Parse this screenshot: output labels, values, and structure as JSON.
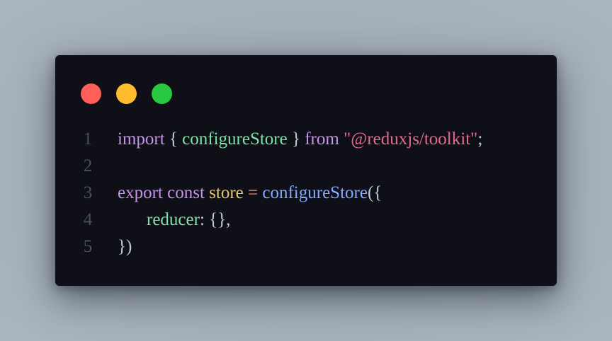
{
  "window": {
    "dots": [
      {
        "name": "close",
        "color": "#ff5f57"
      },
      {
        "name": "minimize",
        "color": "#febc2e"
      },
      {
        "name": "maximize",
        "color": "#28c840"
      }
    ]
  },
  "colors": {
    "background": "#0e0f17",
    "line_number": "#4b4f60",
    "keyword": "#c792ea",
    "identifier": "#7ee3a8",
    "punctuation": "#c3c9d9",
    "string": "#e56a8f",
    "variable": "#e6c66b",
    "operator": "#f78c6c",
    "function": "#82aaff"
  },
  "code": {
    "lines": [
      {
        "number": "1",
        "tokens": [
          {
            "text": "import",
            "color": "#c792ea"
          },
          {
            "text": " { ",
            "color": "#c3c9d9"
          },
          {
            "text": "configureStore",
            "color": "#7ee3a8"
          },
          {
            "text": " } ",
            "color": "#c3c9d9"
          },
          {
            "text": "from",
            "color": "#c792ea"
          },
          {
            "text": " ",
            "color": "#c3c9d9"
          },
          {
            "text": "\"@reduxjs/toolkit\"",
            "color": "#e56a8f"
          },
          {
            "text": ";",
            "color": "#c3c9d9"
          }
        ]
      },
      {
        "number": "2",
        "tokens": []
      },
      {
        "number": "3",
        "tokens": [
          {
            "text": "export",
            "color": "#c792ea"
          },
          {
            "text": " ",
            "color": "#c3c9d9"
          },
          {
            "text": "const",
            "color": "#c792ea"
          },
          {
            "text": " ",
            "color": "#c3c9d9"
          },
          {
            "text": "store",
            "color": "#e6c66b"
          },
          {
            "text": " ",
            "color": "#c3c9d9"
          },
          {
            "text": "=",
            "color": "#f78c6c"
          },
          {
            "text": " ",
            "color": "#c3c9d9"
          },
          {
            "text": "configureStore",
            "color": "#82aaff"
          },
          {
            "text": "({",
            "color": "#c3c9d9"
          }
        ]
      },
      {
        "number": "4",
        "indent": true,
        "tokens": [
          {
            "text": "reducer",
            "color": "#7ee3a8"
          },
          {
            "text": ": {},",
            "color": "#c3c9d9"
          }
        ]
      },
      {
        "number": "5",
        "tokens": [
          {
            "text": "})",
            "color": "#c3c9d9"
          }
        ]
      }
    ]
  }
}
